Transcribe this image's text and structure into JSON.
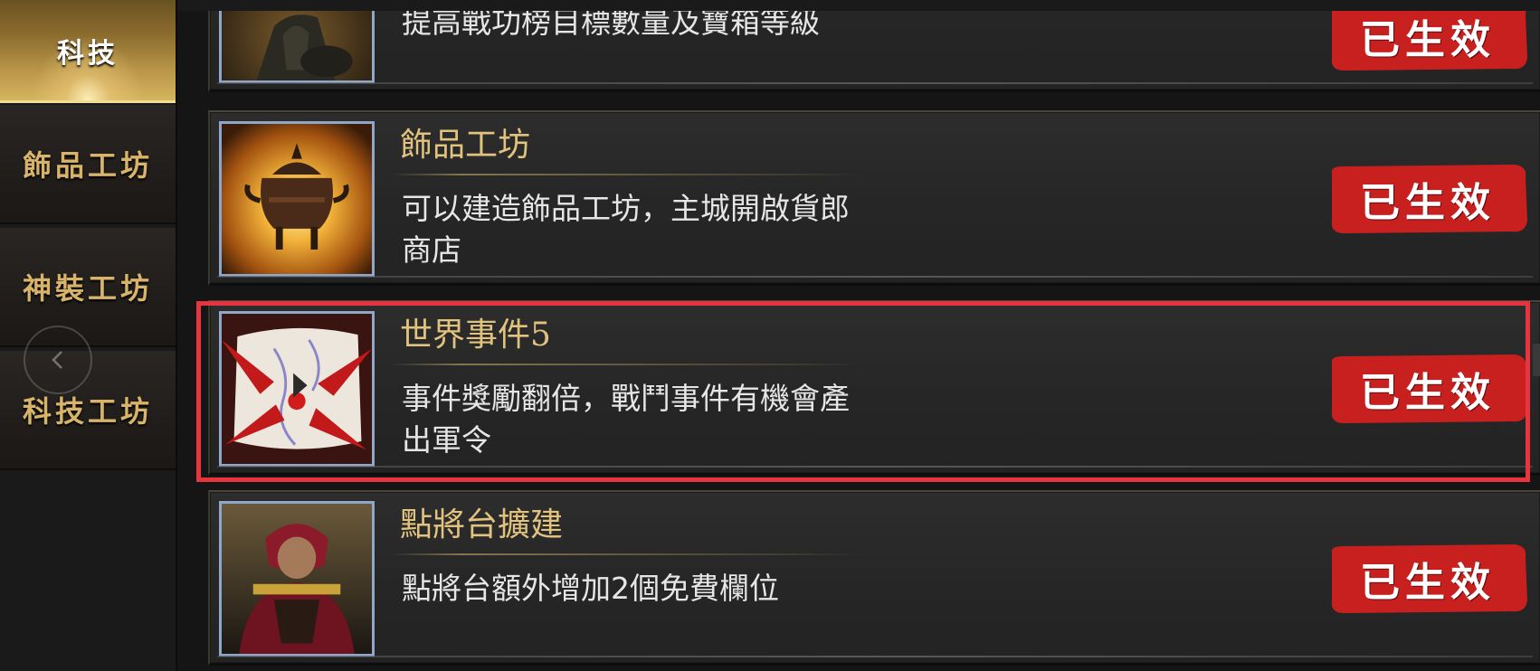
{
  "sidebar": {
    "tabs": [
      {
        "label": "科技",
        "active": true
      },
      {
        "label": "飾品工坊",
        "active": false
      },
      {
        "label": "神裝工坊",
        "active": false
      },
      {
        "label": "科技工坊",
        "active": false
      }
    ]
  },
  "items": [
    {
      "title": "",
      "desc": "提高戰功榜目標數量及寶箱等級",
      "status": "已生效",
      "icon": "horseman-portrait-icon"
    },
    {
      "title": "飾品工坊",
      "desc": "可以建造飾品工坊，主城開啟貨郎商店",
      "status": "已生效",
      "icon": "incense-burner-icon"
    },
    {
      "title": "世界事件5",
      "desc": "事件獎勵翻倍，戰鬥事件有機會產出軍令",
      "status": "已生效",
      "icon": "world-map-event-icon"
    },
    {
      "title": "點將台擴建",
      "desc": "點將台額外增加2個免費欄位",
      "status": "已生效",
      "icon": "general-portrait-icon"
    }
  ],
  "colors": {
    "title_gold": "#e1c37e",
    "button_red": "#c8201f",
    "highlight_red": "#e8343f",
    "icon_border": "#8fa7c9"
  }
}
